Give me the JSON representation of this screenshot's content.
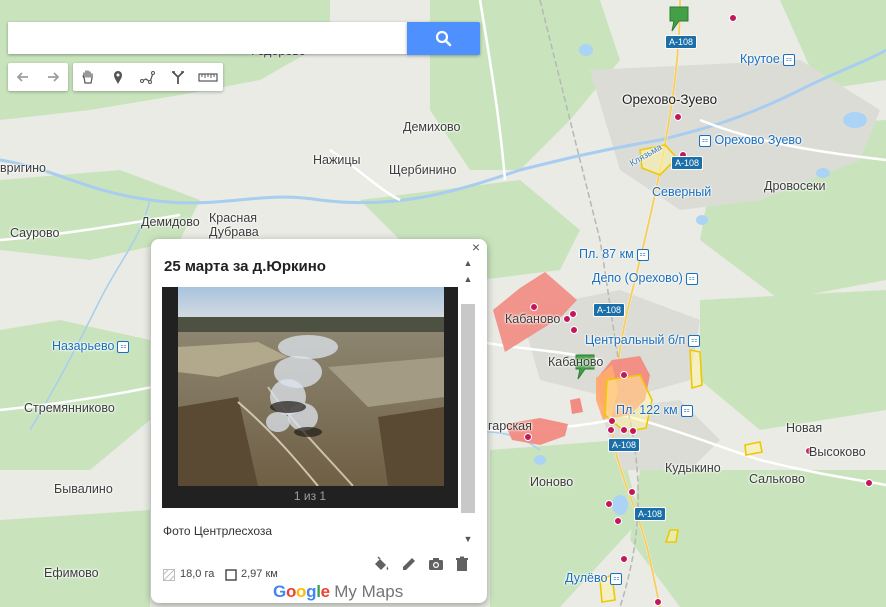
{
  "search": {
    "value": "",
    "placeholder": ""
  },
  "toolbar": {
    "tools": [
      "undo-icon",
      "redo-icon",
      "hand-icon",
      "marker-icon",
      "line-icon",
      "directions-icon",
      "ruler-icon"
    ]
  },
  "map": {
    "places": [
      {
        "name": "Федорово",
        "kind": "village"
      },
      {
        "name": "Орехово-Зуево",
        "kind": "city"
      },
      {
        "name": "Демихово",
        "kind": "village"
      },
      {
        "name": "Нажицы",
        "kind": "village"
      },
      {
        "name": "Щербинино",
        "kind": "village"
      },
      {
        "name": "вригино",
        "kind": "village"
      },
      {
        "name": "Саурово",
        "kind": "village"
      },
      {
        "name": "Демидово",
        "kind": "village"
      },
      {
        "name": "Красная",
        "kind": "village"
      },
      {
        "name": "Дубрава",
        "kind": "village"
      },
      {
        "name": "Назарьево",
        "kind": "village"
      },
      {
        "name": "Стремянниково",
        "kind": "village"
      },
      {
        "name": "Бывалино",
        "kind": "village"
      },
      {
        "name": "Ефимово",
        "kind": "village"
      },
      {
        "name": "Кабаново",
        "kind": "village"
      },
      {
        "name": "Кабаново",
        "kind": "village"
      },
      {
        "name": "Северный",
        "kind": "district"
      },
      {
        "name": "Дровосеки",
        "kind": "village"
      },
      {
        "name": "Новая",
        "kind": "village"
      },
      {
        "name": "Высоково",
        "kind": "village"
      },
      {
        "name": "Кудыкино",
        "kind": "village"
      },
      {
        "name": "Сальково",
        "kind": "village"
      },
      {
        "name": "Ионово",
        "kind": "village"
      },
      {
        "name": "Клязьма",
        "kind": "river"
      },
      {
        "name": "гарская",
        "kind": "village"
      }
    ],
    "stations": [
      "Крутое",
      "Орехово Зуево",
      "Пл. 87 км",
      "Депо (Орехово)",
      "Центральный б/п",
      "Пл. 122 км",
      "Назарьево",
      "Дулёво"
    ],
    "road_shields": [
      "A-108",
      "A-108",
      "A-108",
      "A-108",
      "A-108"
    ]
  },
  "popup": {
    "title": "25 марта за д.Юркино",
    "photo_counter": "1 из 1",
    "caption": "Фото Центрлесхоза",
    "area": "18,0 га",
    "perimeter": "2,97 км",
    "actions": [
      "paint-bucket-icon",
      "pencil-icon",
      "camera-icon",
      "trash-icon"
    ],
    "close": "×",
    "scroll_up": "▲",
    "scroll_down": "▼"
  },
  "brand": {
    "google": "Google",
    "product": "My Maps"
  },
  "colors": {
    "fire_zone": "#f28b82",
    "fire_zone_orange": "#ffab70",
    "yellow_outline": "#f5e042",
    "marker_green": "#43a047",
    "dot": "#c2185b",
    "search_blue": "#4d90fe"
  }
}
